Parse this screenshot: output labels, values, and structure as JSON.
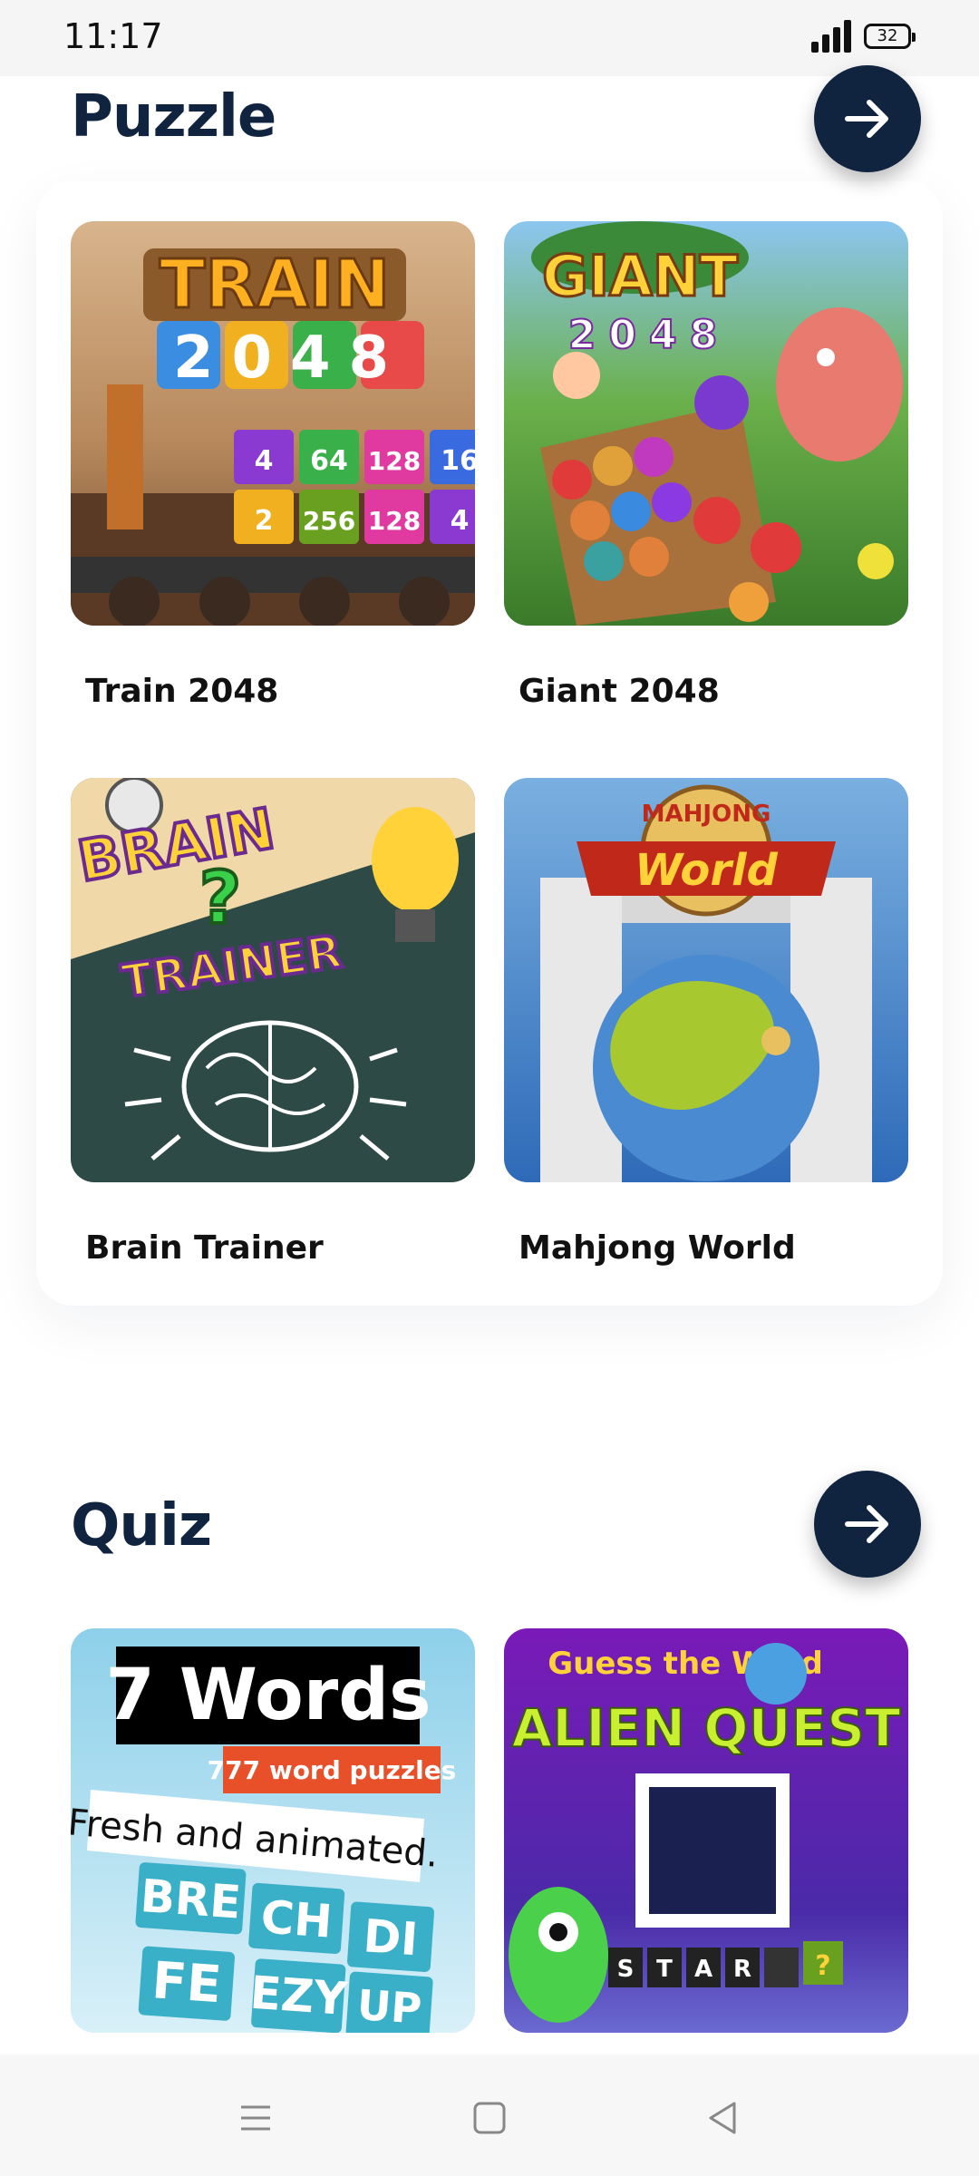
{
  "status": {
    "time": "11:17",
    "battery": "32"
  },
  "puzzle": {
    "title": "Puzzle",
    "cards": [
      {
        "label": "Train 2048",
        "art": {
          "line1": "TRAIN",
          "line2": "2048",
          "tiles": [
            "4",
            "64",
            "128",
            "16",
            "2",
            "256",
            "128",
            "4"
          ]
        }
      },
      {
        "label": "Giant 2048",
        "art": {
          "line1": "GIANT",
          "line2": "2048"
        }
      },
      {
        "label": "Brain Trainer",
        "art": {
          "line1": "BRAIN",
          "line2": "?",
          "line3": "TRAINER"
        }
      },
      {
        "label": "Mahjong World",
        "art": {
          "line1": "MAHJONG",
          "line2": "World"
        }
      }
    ]
  },
  "quiz": {
    "title": "Quiz",
    "cards": [
      {
        "art": {
          "title": "7 Words",
          "sub": "777 word puzzles",
          "tag": "Fresh and animated.",
          "tiles": [
            "BRE",
            "CH",
            "DI",
            "FE",
            "EZY",
            "UP"
          ]
        }
      },
      {
        "art": {
          "line1": "Guess the Word",
          "line2": "ALIEN QUEST",
          "letters": [
            "S",
            "T",
            "A",
            "R"
          ]
        }
      }
    ]
  },
  "colors": {
    "accent": "#10233f",
    "background": "#ffffff"
  },
  "icons": {
    "arrow": "arrow-right-icon",
    "menu": "menu-icon",
    "home": "home-square-icon",
    "back": "back-triangle-icon"
  }
}
